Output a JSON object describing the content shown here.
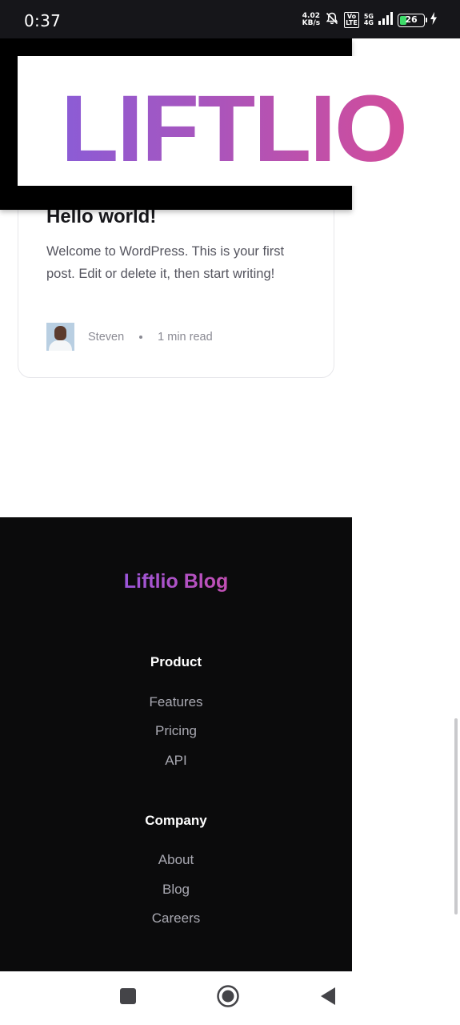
{
  "status_bar": {
    "time": "0:37",
    "net_speed_value": "4.02",
    "net_speed_unit": "KB/s",
    "volte_top": "Vo",
    "volte_bottom": "LTE",
    "network_gen": "5G",
    "network_sub": "4G",
    "battery_level": "26",
    "icons": [
      "bell-off-icon",
      "signal-icon",
      "battery-icon",
      "charging-icon"
    ],
    "battery_color": "#3ddc6a"
  },
  "header": {
    "logo_text": "LIFTLIO",
    "logo_gradient": [
      "#8b5cd6",
      "#d24c9a"
    ]
  },
  "post": {
    "title": "Hello world!",
    "excerpt": "Welcome to WordPress. This is your first post. Edit or delete it, then start writing!",
    "author": "Steven",
    "read_time": "1 min read"
  },
  "footer": {
    "brand": "Liftlio Blog",
    "sections": [
      {
        "heading": "Product",
        "links": [
          "Features",
          "Pricing",
          "API"
        ]
      },
      {
        "heading": "Company",
        "links": [
          "About",
          "Blog",
          "Careers"
        ]
      }
    ],
    "background": "#0b0b0c"
  },
  "nav_bar": {
    "buttons": [
      "recents-icon",
      "home-icon",
      "back-icon"
    ]
  }
}
